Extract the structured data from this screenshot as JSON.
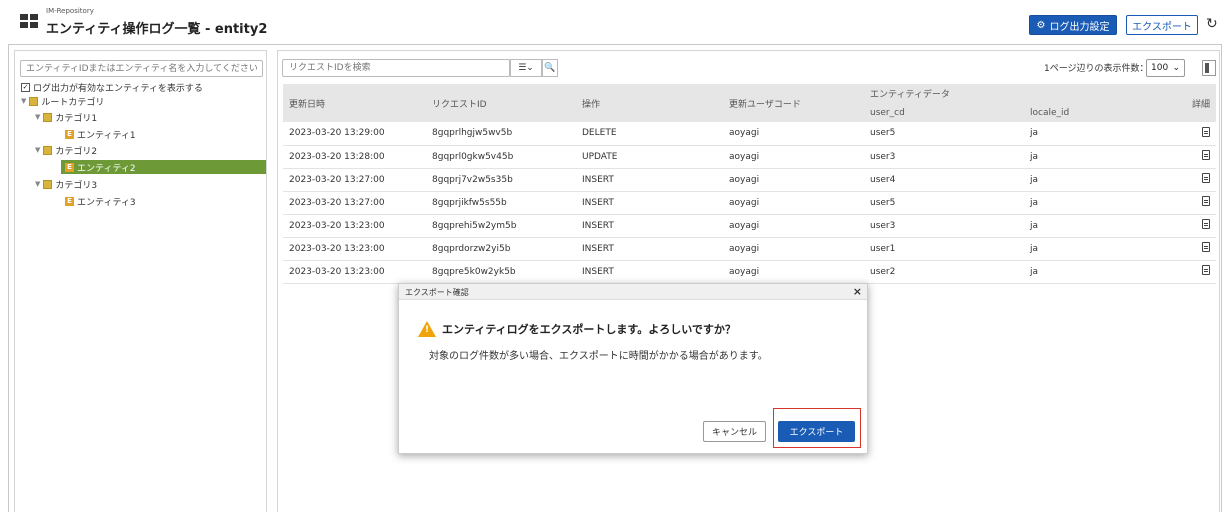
{
  "header": {
    "app_name": "IM-Repository",
    "title": "エンティティ操作ログ一覧 - entity2",
    "log_settings_label": "ログ出力設定",
    "export_label": "エクスポート"
  },
  "left": {
    "search_placeholder": "エンティティIDまたはエンティティ名を入力してください",
    "show_logged_label": "ログ出力が有効なエンティティを表示する",
    "tree": {
      "root": "ルートカテゴリ",
      "cat1": "カテゴリ1",
      "entity1": "エンティティ1",
      "cat2": "カテゴリ2",
      "entity2": "エンティティ2",
      "cat3": "カテゴリ3",
      "entity3": "エンティティ3",
      "entity_badge": "E"
    }
  },
  "right": {
    "search_placeholder": "リクエストIDを検索",
    "per_page_label": "1ページ辺りの表示件数：",
    "per_page_value": "100",
    "columns": {
      "updated_at": "更新日時",
      "request_id": "リクエストID",
      "operation": "操作",
      "user_code": "更新ユーザコード",
      "entity_data": "エンティティデータ",
      "user_cd": "user_cd",
      "locale_id": "locale_id",
      "detail": "詳細"
    },
    "rows": [
      {
        "date": "2023-03-20 13:29:00",
        "req": "8gqprlhgjw5wv5b",
        "op": "DELETE",
        "user": "aoyagi",
        "cd": "user5",
        "loc": "ja"
      },
      {
        "date": "2023-03-20 13:28:00",
        "req": "8gqprl0gkw5v45b",
        "op": "UPDATE",
        "user": "aoyagi",
        "cd": "user3",
        "loc": "ja"
      },
      {
        "date": "2023-03-20 13:27:00",
        "req": "8gqprj7v2w5s35b",
        "op": "INSERT",
        "user": "aoyagi",
        "cd": "user4",
        "loc": "ja"
      },
      {
        "date": "2023-03-20 13:27:00",
        "req": "8gqprjikfw5s55b",
        "op": "INSERT",
        "user": "aoyagi",
        "cd": "user5",
        "loc": "ja"
      },
      {
        "date": "2023-03-20 13:23:00",
        "req": "8gqprehi5w2ym5b",
        "op": "INSERT",
        "user": "aoyagi",
        "cd": "user3",
        "loc": "ja"
      },
      {
        "date": "2023-03-20 13:23:00",
        "req": "8gqprdorzw2yi5b",
        "op": "INSERT",
        "user": "aoyagi",
        "cd": "user1",
        "loc": "ja"
      },
      {
        "date": "2023-03-20 13:23:00",
        "req": "8gqpre5k0w2yk5b",
        "op": "INSERT",
        "user": "aoyagi",
        "cd": "user2",
        "loc": "ja"
      }
    ]
  },
  "dialog": {
    "title": "エクスポート確認",
    "message": "エンティティログをエクスポートします。よろしいですか？",
    "sub_message": "対象のログ件数が多い場合、エクスポートに時間がかかる場合があります。",
    "cancel_label": "キャンセル",
    "export_label": "エクスポート"
  },
  "colors": {
    "primary": "#1a5bb5",
    "selected_tree": "#6d9937",
    "warning": "#f0a30a",
    "highlight": "#d9342b"
  }
}
